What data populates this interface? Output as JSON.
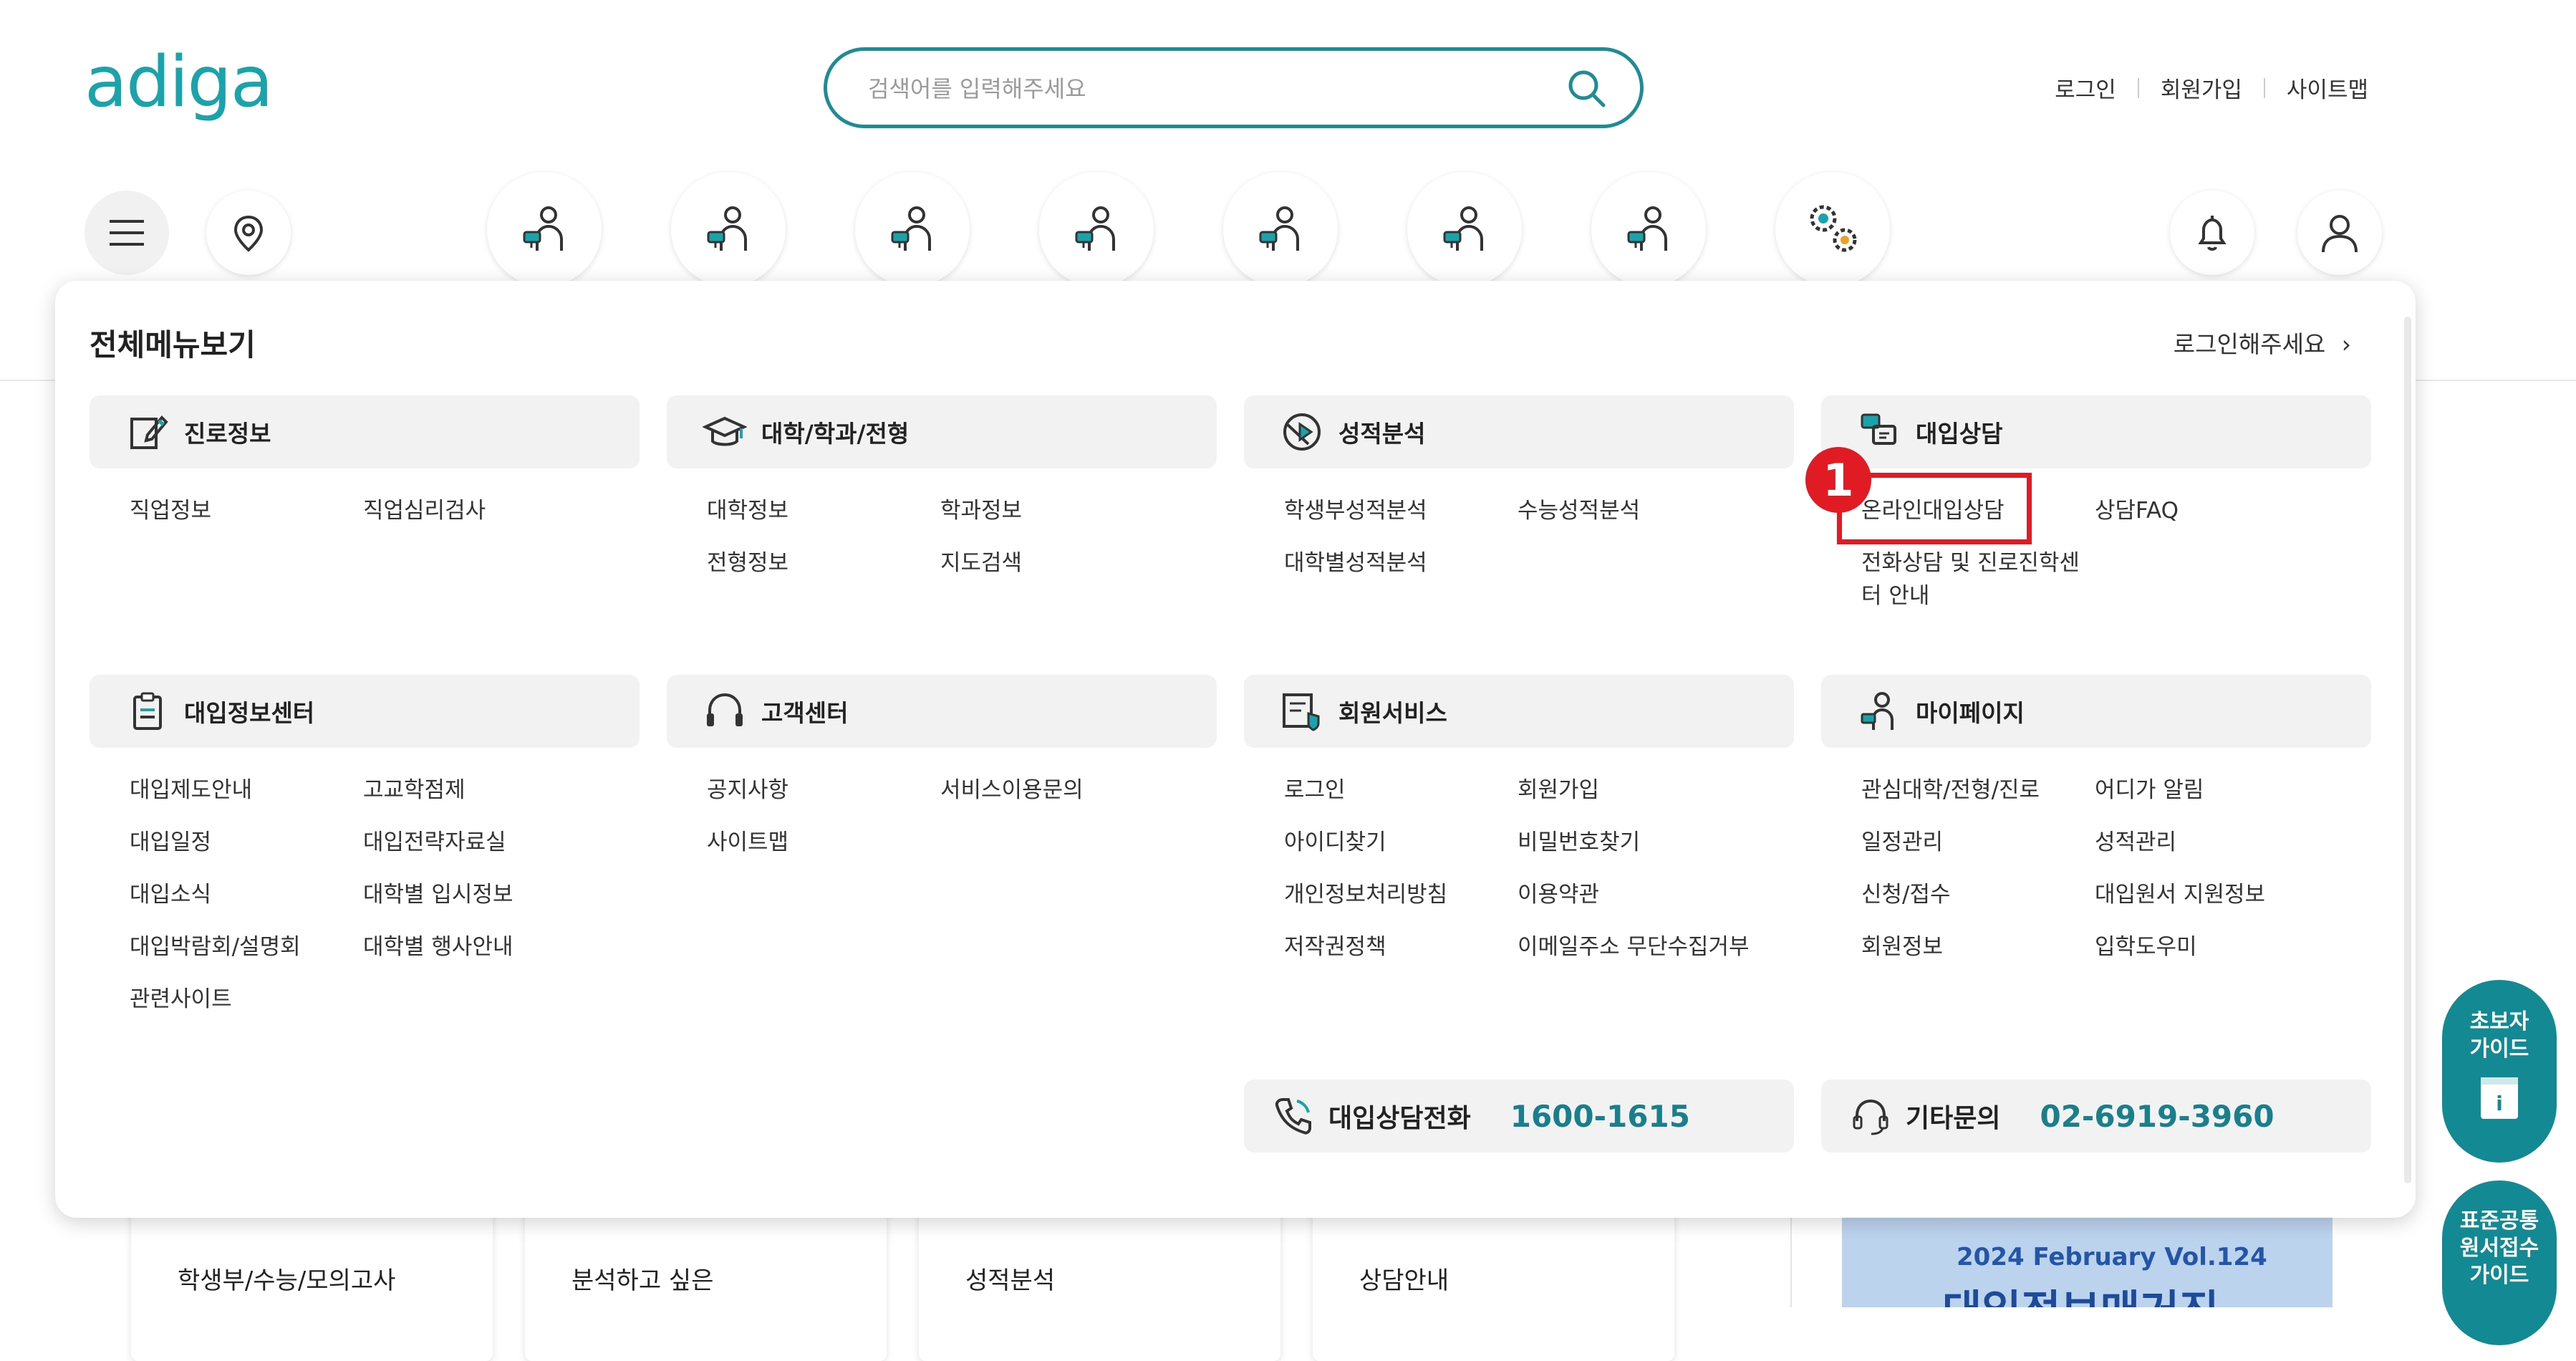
{
  "header": {
    "logo": "adiga",
    "search_placeholder": "검색어를 입력해주세요",
    "links": [
      "로그인",
      "회원가입",
      "사이트맵"
    ]
  },
  "menu": {
    "title": "전체메뉴보기",
    "login_prompt": "로그인해주세요",
    "categories": [
      {
        "label": "진로정보",
        "icon": "career-edit-icon",
        "items": [
          "직업정보",
          "직업심리검사"
        ]
      },
      {
        "label": "대학/학과/전형",
        "icon": "graduation-cap-icon",
        "items": [
          "대학정보",
          "학과정보",
          "전형정보",
          "지도검색"
        ]
      },
      {
        "label": "성적분석",
        "icon": "analysis-icon",
        "items": [
          "학생부성적분석",
          "수능성적분석",
          "대학별성적분석"
        ]
      },
      {
        "label": "대입상담",
        "icon": "consult-icon",
        "items": [
          "온라인대입상담",
          "상담FAQ",
          "전화상담 및 진로진학센",
          "터 안내"
        ]
      },
      {
        "label": "대입정보센터",
        "icon": "clipboard-icon",
        "items": [
          "대입제도안내",
          "고교학점제",
          "대입일정",
          "대입전략자료실",
          "대입소식",
          "대학별 입시정보",
          "대입박람회/설명회",
          "대학별 행사안내",
          "관련사이트"
        ]
      },
      {
        "label": "고객센터",
        "icon": "headset-icon",
        "items": [
          "공지사항",
          "서비스이용문의",
          "사이트맵"
        ]
      },
      {
        "label": "회원서비스",
        "icon": "member-service-icon",
        "items": [
          "로그인",
          "회원가입",
          "아이디찾기",
          "비밀번호찾기",
          "개인정보처리방침",
          "이용약관",
          "저작권정책",
          "이메일주소 무단수집거부"
        ]
      },
      {
        "label": "마이페이지",
        "icon": "mypage-icon",
        "items": [
          "관심대학/전형/진로",
          "어디가 알림",
          "일정관리",
          "성적관리",
          "신청/접수",
          "대입원서 지원정보",
          "회원정보",
          "입학도우미"
        ]
      }
    ],
    "phone": {
      "label": "대입상담전화",
      "number": "1600-1615"
    },
    "other": {
      "label": "기타문의",
      "number": "02-6919-3960"
    },
    "annotation_badge": "1"
  },
  "float": {
    "beginner": [
      "초보자",
      "가이드"
    ],
    "common": [
      "표준공통",
      "원서접수",
      "가이드"
    ]
  },
  "bottom": {
    "cards": [
      "학생부/수능/모의고사",
      "분석하고 싶은",
      "성적분석",
      "상담안내"
    ],
    "magazine": "2024 February Vol.124",
    "magazine_title": "대입정보매거진"
  },
  "colors": {
    "accent": "#1aa3ab",
    "highlight": "#e01b24",
    "phone": "#1a7f8a"
  }
}
